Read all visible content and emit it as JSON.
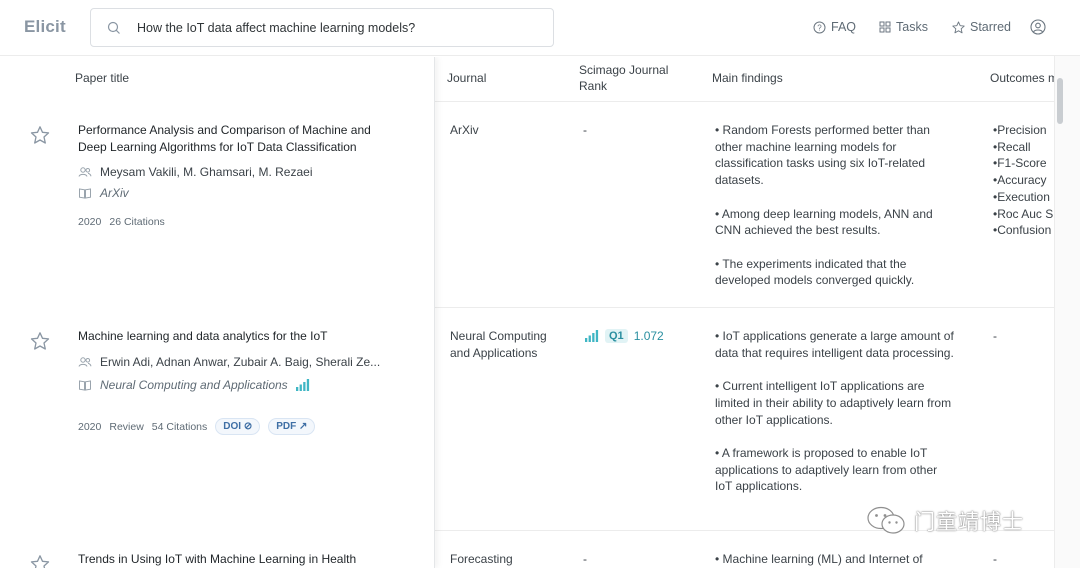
{
  "app": {
    "brand": "Elicit"
  },
  "search": {
    "query": "How the IoT data affect machine learning models?"
  },
  "nav": {
    "faq": "FAQ",
    "tasks": "Tasks",
    "starred": "Starred"
  },
  "columns": {
    "paper_title": "Paper title",
    "journal": "Journal",
    "rank_line1": "Scimago Journal",
    "rank_line2": "Rank",
    "findings": "Main findings",
    "outcomes": "Outcomes m"
  },
  "rows": [
    {
      "title": "Performance Analysis and Comparison of Machine and Deep Learning Algorithms for IoT Data Classification",
      "authors": "Meysam Vakili, M. Ghamsari, M. Rezaei",
      "venue": "ArXiv",
      "year": "2020",
      "citations": "26 Citations",
      "journal": "ArXiv",
      "rank": "-",
      "findings": [
        "• Random Forests performed better than other machine learning models for classification tasks using six IoT-related datasets.",
        "• Among deep learning models, ANN and CNN achieved the best results.",
        "• The experiments indicated that the developed models converged quickly."
      ],
      "outcomes": [
        "•Precision",
        "•Recall",
        "•F1-Score",
        "•Accuracy",
        "•Execution",
        "•Roc Auc S",
        "•Confusion"
      ]
    },
    {
      "title": "Machine learning and data analytics for the IoT",
      "authors": "Erwin Adi, Adnan Anwar, Zubair A. Baig, Sherali Ze...",
      "venue": "Neural Computing and Applications",
      "year": "2020",
      "type": "Review",
      "citations": "54 Citations",
      "doi": "DOI",
      "pdf": "PDF",
      "journal": "Neural Computing and Applications",
      "rank_quartile": "Q1",
      "rank_value": "1.072",
      "findings": [
        "• IoT applications generate a large amount of data that requires intelligent data processing.",
        "• Current intelligent IoT applications are limited in their ability to adaptively learn from other IoT applications.",
        "• A framework is proposed to enable IoT applications to adaptively learn from other IoT applications."
      ],
      "outcomes": "-"
    },
    {
      "title": "Trends in Using IoT with Machine Learning in Health",
      "journal": "Forecasting",
      "rank": "-",
      "findings_first": "• Machine learning (ML) and Internet of",
      "outcomes": "-"
    }
  ],
  "watermark": {
    "text": "门童靖博士"
  },
  "colors": {
    "accent": "#2a8fa0",
    "brand": "#8a96a3",
    "link": "#3f6fa5"
  }
}
